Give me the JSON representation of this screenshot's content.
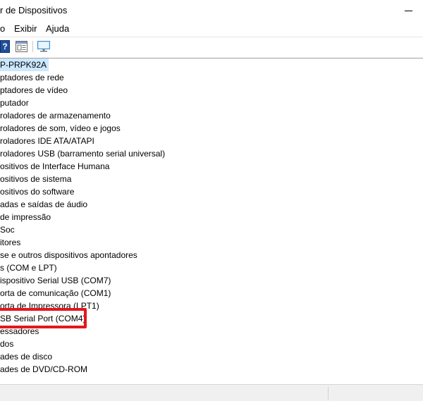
{
  "window": {
    "title": "r de Dispositivos"
  },
  "menubar": {
    "items": [
      {
        "label": "o"
      },
      {
        "label": "Exibir"
      },
      {
        "label": "Ajuda"
      }
    ]
  },
  "toolbar": {
    "help_glyph": "?"
  },
  "tree": {
    "root": "P-PRPK92A",
    "items": [
      "ptadores de rede",
      "ptadores de vídeo",
      "putador",
      "roladores de armazenamento",
      "roladores de som, vídeo e jogos",
      "roladores IDE ATA/ATAPI",
      "roladores USB (barramento serial universal)",
      "ositivos de Interface Humana",
      "ositivos de sistema",
      "ositivos do software",
      "adas e saídas de áudio",
      " de impressão",
      "Soc",
      "itores",
      "se e outros dispositivos apontadores",
      "s (COM e LPT)",
      "ispositivo Serial USB (COM7)",
      "orta de comunicação (COM1)",
      "orta de Impressora (LPT1)",
      "SB Serial Port (COM4)",
      "essadores",
      "dos",
      "ades de disco",
      "ades de DVD/CD-ROM"
    ]
  },
  "colors": {
    "selection": "#cce8ff",
    "highlight_border": "#e5161c"
  }
}
